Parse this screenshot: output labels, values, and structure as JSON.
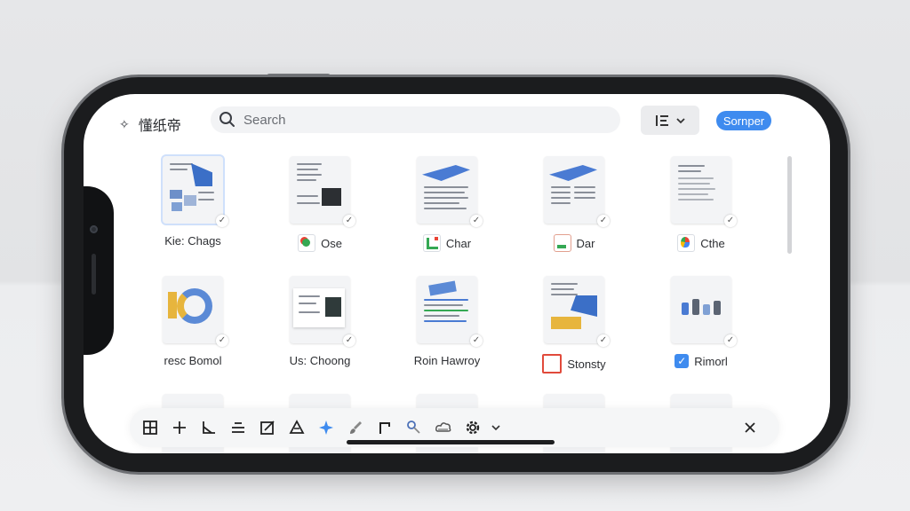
{
  "app": {
    "title": "懂纸帝"
  },
  "search": {
    "placeholder": "Search"
  },
  "header": {
    "primary_button": "Sornper"
  },
  "files": [
    {
      "label": "Kie: Chags",
      "selected": true,
      "icon": "none"
    },
    {
      "label": "Ose",
      "selected": true,
      "icon": "green-app-icon"
    },
    {
      "label": "Char",
      "selected": true,
      "icon": "sheets-icon"
    },
    {
      "label": "Dar",
      "selected": true,
      "icon": "file-red-icon"
    },
    {
      "label": "Cthe",
      "selected": true,
      "icon": "multicolor-app-icon"
    },
    {
      "label": "resc Bomol",
      "selected": true,
      "icon": "none"
    },
    {
      "label": "Us: Choong",
      "selected": true,
      "icon": "none"
    },
    {
      "label": "Roin Hawroy",
      "selected": true,
      "icon": "none"
    },
    {
      "label": "Stonsty",
      "selected": true,
      "icon": "slides-red-icon"
    },
    {
      "label": "Rimorl",
      "selected": true,
      "icon": "blue-check-icon"
    }
  ],
  "toolbar": {
    "tools": [
      "grid-icon",
      "plus-icon",
      "angle-icon",
      "align-icon",
      "edit-icon",
      "shapes-icon",
      "sparkle-icon",
      "brush-icon",
      "connector-icon",
      "search-path-icon",
      "cloud-icon",
      "settings-icon"
    ],
    "more": "chevron-down-icon",
    "close": "close-icon"
  },
  "colors": {
    "accent": "#3e8bef",
    "background": "#ffffff",
    "frame": "#1b1c1e"
  }
}
